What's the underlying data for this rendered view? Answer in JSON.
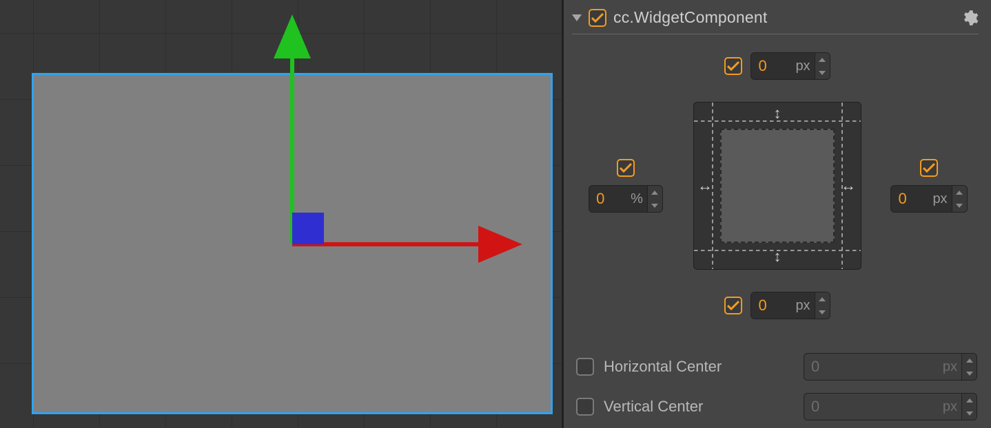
{
  "component": {
    "title": "cc.WidgetComponent",
    "enabled": true
  },
  "anchors": {
    "top": {
      "enabled": true,
      "value": "0",
      "unit": "px"
    },
    "bottom": {
      "enabled": true,
      "value": "0",
      "unit": "px"
    },
    "left": {
      "enabled": true,
      "value": "0",
      "unit": "%"
    },
    "right": {
      "enabled": true,
      "value": "0",
      "unit": "px"
    }
  },
  "center": {
    "horizontal": {
      "label": "Horizontal Center",
      "enabled": false,
      "value": "0",
      "unit": "px"
    },
    "vertical": {
      "label": "Vertical Center",
      "enabled": false,
      "value": "0",
      "unit": "px"
    }
  },
  "colors": {
    "accent": "#f39b21",
    "selection": "#2ea3f2",
    "axis_x": "#d11313",
    "axis_y": "#1fc21f",
    "origin": "#2f2fd1"
  }
}
